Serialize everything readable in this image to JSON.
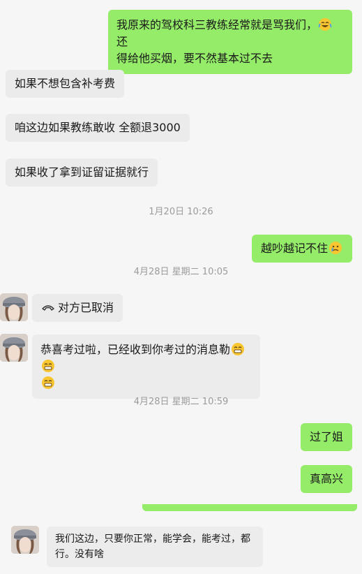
{
  "messages": {
    "m1": "我原来的驾校科三教练经常就是骂我们，",
    "m1_tail": "还",
    "m1_line2": "得给他买烟，要不然基本过不去",
    "m2": "如果不想包含补考费",
    "m3": "咱这边如果教练敢收 全额退3000",
    "m4": "如果收了拿到证留证据就行",
    "ts1": "1月20日 10:26",
    "m5": "越吵越记不住",
    "ts2": "4月28日 星期二 10:05",
    "m6": "对方已取消",
    "m7_line1": "恭喜考过啦，已经收到你考过的消息勒",
    "ts3": "4月28日 星期二 10:59",
    "m8": "过了姐",
    "m9": "真高兴",
    "m10_line1": "我们这边，只要你正常，能学会，能考过，都",
    "m10_line2": "行。没有啥"
  },
  "icons": {
    "laugh_cry": "face-with-tears-of-joy-icon",
    "sad": "crying-face-icon",
    "grin": "grinning-face-icon",
    "phone": "phone-hangup-icon",
    "avatar": "avatar"
  },
  "colors": {
    "outgoing": "#95ec69",
    "incoming": "#ebebeb",
    "background": "#f6f6f6",
    "timestamp": "#9b9b9b"
  }
}
